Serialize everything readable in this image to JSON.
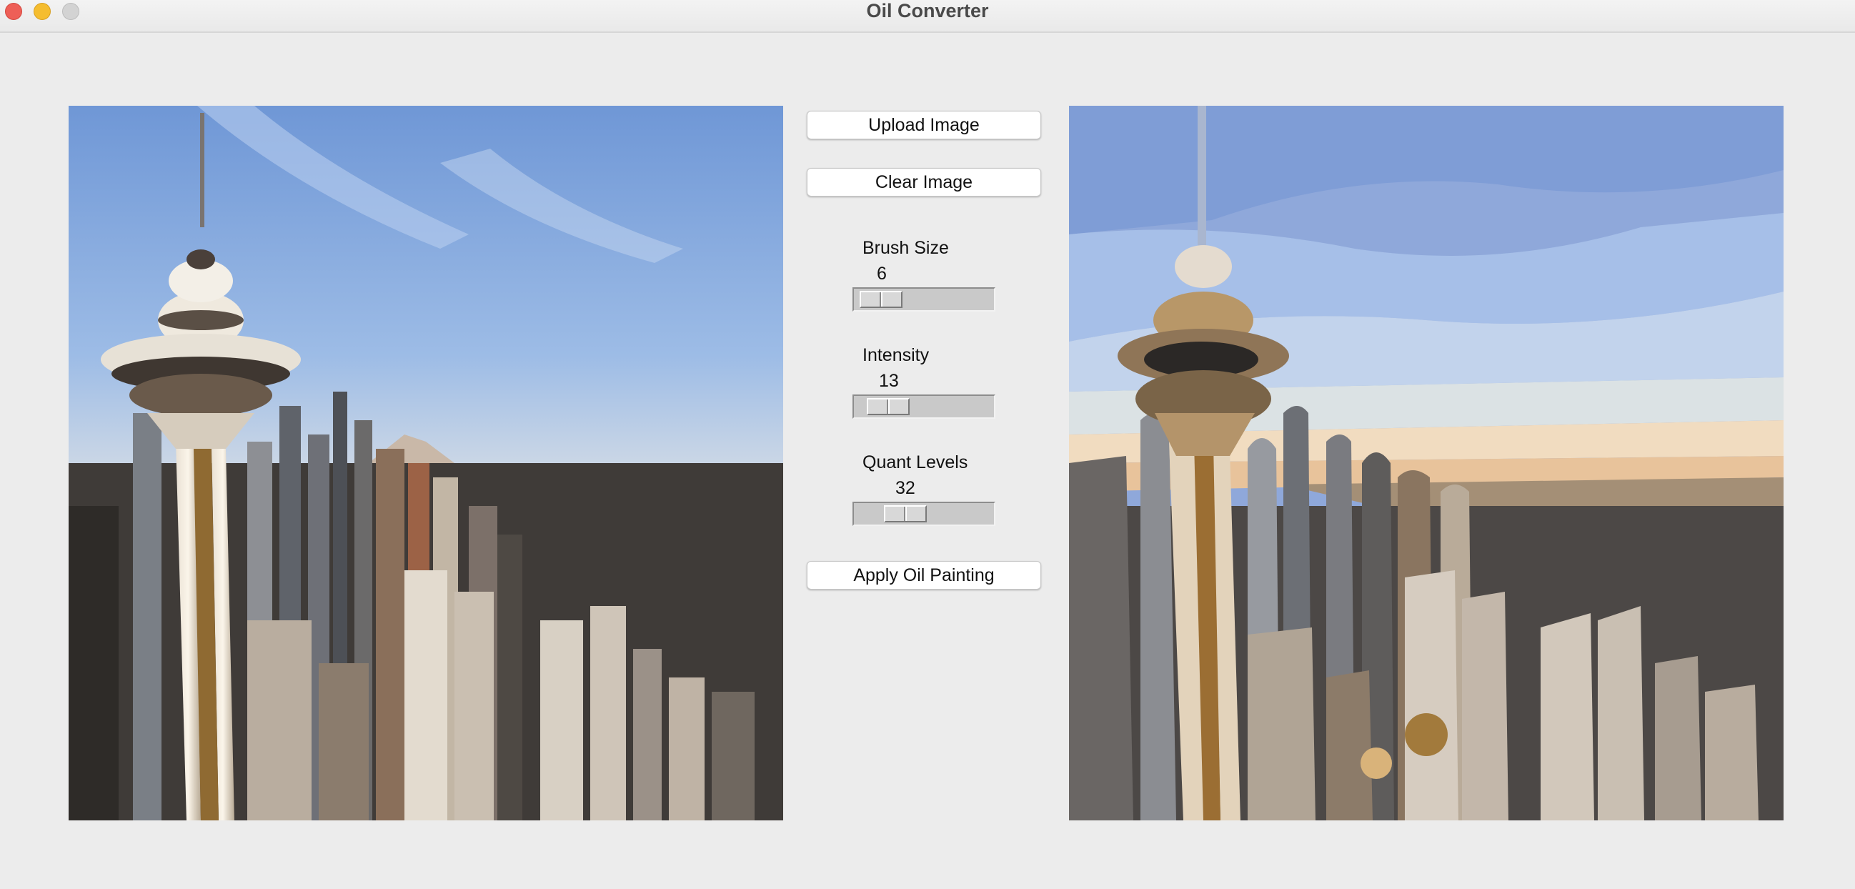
{
  "window": {
    "title": "Oil Converter"
  },
  "controls": {
    "upload_label": "Upload Image",
    "clear_label": "Clear Image",
    "apply_label": "Apply Oil Painting"
  },
  "sliders": {
    "brush_size": {
      "label": "Brush Size",
      "value": "6"
    },
    "intensity": {
      "label": "Intensity",
      "value": "13"
    },
    "quant_levels": {
      "label": "Quant Levels",
      "value": "32"
    }
  },
  "colors": {
    "close": "#ee5f57",
    "minimize": "#f5bd2f",
    "zoom": "#d3d3d3",
    "sky_top": "#7fa3dd",
    "sky_horizon": "#f1d7b8",
    "water": "#7aa7c2"
  }
}
